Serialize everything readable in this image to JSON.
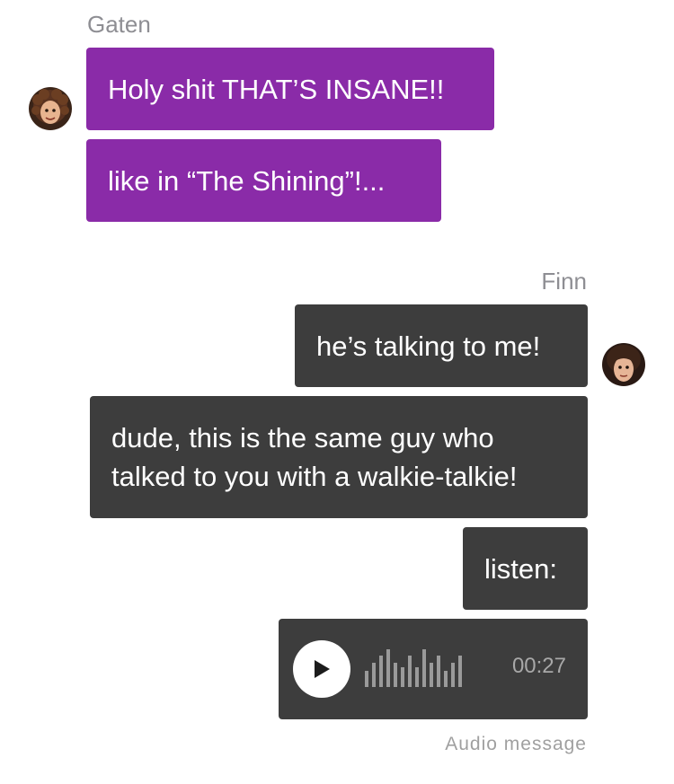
{
  "thread": {
    "incoming": {
      "sender": "Gaten",
      "messages": [
        "Holy shit THAT’S INSANE!!",
        "like in “The Shining”!..."
      ]
    },
    "outgoing": {
      "sender": "Finn",
      "messages": [
        "he’s talking to me!",
        "dude, this is the same guy who talked to you with a walkie-talkie!",
        "listen:"
      ],
      "audio": {
        "duration": "00:27",
        "caption": "Audio message",
        "waveform_levels": [
          0.42,
          0.62,
          0.8,
          0.95,
          0.62,
          0.5,
          0.8,
          0.5,
          0.95,
          0.62,
          0.8,
          0.42,
          0.62,
          0.8
        ]
      }
    }
  },
  "colors": {
    "incoming_bubble": "#8a2ba8",
    "outgoing_bubble": "#3d3d3d",
    "sender_text": "#8e8e93"
  },
  "icons": {
    "play": "play-icon",
    "avatar_gaten": "avatar-gaten",
    "avatar_finn": "avatar-finn"
  }
}
